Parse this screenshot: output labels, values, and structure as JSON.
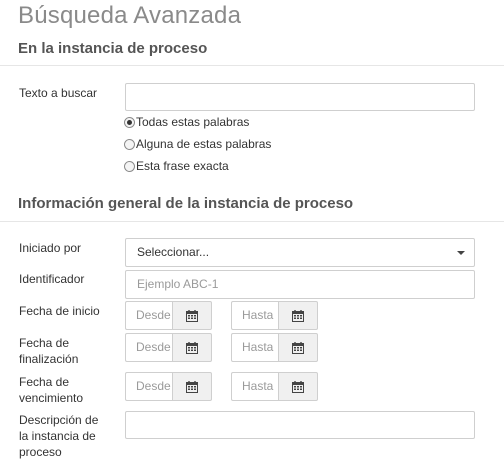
{
  "page": {
    "title": "Búsqueda Avanzada"
  },
  "section1": {
    "title": "En la instancia de proceso",
    "search_label": "Texto a buscar",
    "search_value": "",
    "options": [
      {
        "label": "Todas estas palabras",
        "selected": true
      },
      {
        "label": "Alguna de estas palabras",
        "selected": false
      },
      {
        "label": "Esta frase exacta",
        "selected": false
      }
    ]
  },
  "section2": {
    "title": "Información general de la instancia de proceso",
    "started_by": {
      "label": "Iniciado por",
      "value": "Seleccionar..."
    },
    "identifier": {
      "label": "Identificador",
      "placeholder": "Ejemplo ABC-1"
    },
    "start_date": {
      "label": "Fecha de inicio",
      "from_placeholder": "Desde",
      "to_placeholder": "Hasta",
      "icon": "calendar-icon"
    },
    "end_date": {
      "label_line1": "Fecha de",
      "label_line2": "finalización",
      "from_placeholder": "Desde",
      "to_placeholder": "Hasta",
      "icon": "calendar-icon"
    },
    "due_date": {
      "label_line1": "Fecha de",
      "label_line2": "vencimiento",
      "from_placeholder": "Desde",
      "to_placeholder": "Hasta",
      "icon": "calendar-icon"
    },
    "description": {
      "label_line1": "Descripción de",
      "label_line2": "la instancia de",
      "label_line3": "proceso",
      "value": ""
    }
  }
}
